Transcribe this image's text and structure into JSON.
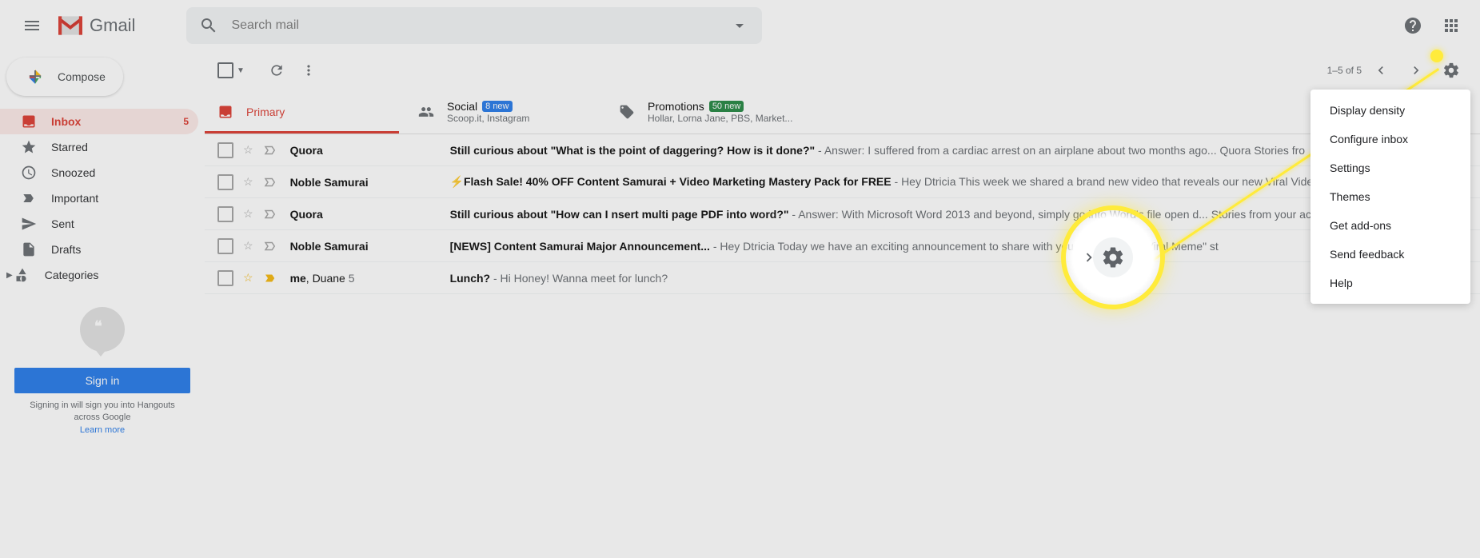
{
  "header": {
    "logo_text": "Gmail",
    "search_placeholder": "Search mail"
  },
  "sidebar": {
    "compose_label": "Compose",
    "items": [
      {
        "label": "Inbox",
        "count": "5"
      },
      {
        "label": "Starred"
      },
      {
        "label": "Snoozed"
      },
      {
        "label": "Important"
      },
      {
        "label": "Sent"
      },
      {
        "label": "Drafts"
      },
      {
        "label": "Categories"
      }
    ],
    "signin_label": "Sign in",
    "signin_text1": "Signing in will sign you into Hangouts",
    "signin_text2": "across Google",
    "learn_more": "Learn more"
  },
  "toolbar": {
    "pagination": "1–5 of 5"
  },
  "tabs": [
    {
      "label": "Primary"
    },
    {
      "label": "Social",
      "badge": "8 new",
      "sub": "Scoop.it, Instagram"
    },
    {
      "label": "Promotions",
      "badge": "50 new",
      "sub": "Hollar, Lorna Jane, PBS, Market..."
    }
  ],
  "emails": [
    {
      "sender": "Quora",
      "subject": "Still curious about \"What is the point of daggering? How is it done?\"",
      "snippet": " - Answer: I suffered from a cardiac arrest on an airplane about two months ago... Quora Stories fro"
    },
    {
      "sender": "Noble Samurai",
      "subject": "⚡Flash Sale! 40% OFF Content Samurai + Video Marketing Mastery Pack for FREE",
      "snippet": " - Hey Dtricia This week we shared a brand new video that reveals our new Viral Vide"
    },
    {
      "sender": "Quora",
      "subject": "Still curious about \"How can I nsert multi page PDF into word?\"",
      "snippet": " - Answer: With Microsoft Word 2013 and beyond, simply go into Word's file open d... Stories from your ac"
    },
    {
      "sender": "Noble Samurai",
      "subject": "[NEWS] Content Samurai Major Announcement...",
      "snippet": " - Hey Dtricia Today we have an exciting announcement to share with you              eate popular \"Viral Meme\" st"
    },
    {
      "sender_html": "me, Duane 5",
      "sender_a": "me",
      "sender_b": ", Duane ",
      "sender_c": "5",
      "subject": "Lunch?",
      "snippet": " - Hi Honey! Wanna meet for lunch?",
      "starred": true
    }
  ],
  "settings_menu": [
    "Display density",
    "Configure inbox",
    "Settings",
    "Themes",
    "Get add-ons",
    "Send feedback",
    "Help"
  ]
}
